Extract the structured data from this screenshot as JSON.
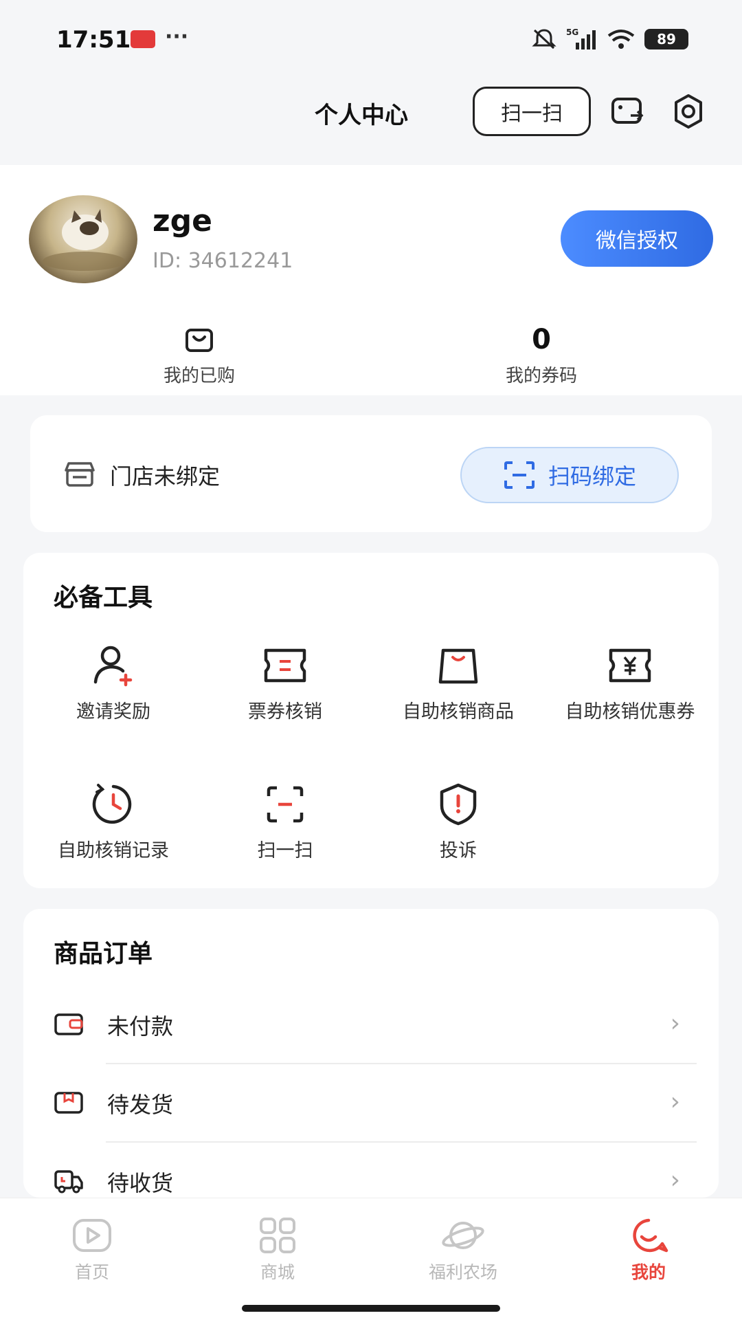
{
  "status_bar": {
    "time": "17:51",
    "dots": "···",
    "network": "5G",
    "battery": "89",
    "icons": [
      "app-notification-icon",
      "mute-icon",
      "signal-icon",
      "wifi-icon",
      "battery-icon"
    ]
  },
  "header": {
    "title": "个人中心",
    "scan_button": "扫一扫",
    "icons": [
      "card-switch-icon",
      "settings-icon"
    ]
  },
  "profile": {
    "name": "zge",
    "id_text": "ID: 34612241",
    "wechat_button": "微信授权",
    "stats": [
      {
        "value": "",
        "label": "我的已购",
        "icon": "bag-icon"
      },
      {
        "value": "0",
        "label": "我的券码"
      }
    ]
  },
  "store": {
    "status_text": "门店未绑定",
    "bind_button": "扫码绑定"
  },
  "tools": {
    "title": "必备工具",
    "items": [
      {
        "label": "邀请奖励",
        "icon": "invite-user-icon"
      },
      {
        "label": "票券核销",
        "icon": "ticket-icon"
      },
      {
        "label": "自助核销商品",
        "icon": "product-bag-icon"
      },
      {
        "label": "自助核销优惠券",
        "icon": "coupon-yen-icon"
      },
      {
        "label": "自助核销记录",
        "icon": "history-clock-icon"
      },
      {
        "label": "扫一扫",
        "icon": "scan-icon"
      },
      {
        "label": "投诉",
        "icon": "complaint-shield-icon"
      }
    ]
  },
  "orders": {
    "title": "商品订单",
    "rows": [
      {
        "label": "未付款",
        "icon": "wallet-icon"
      },
      {
        "label": "待发货",
        "icon": "package-icon"
      },
      {
        "label": "待收货",
        "icon": "truck-icon"
      }
    ]
  },
  "bottom_nav": {
    "items": [
      {
        "label": "首页",
        "icon": "play-home-icon"
      },
      {
        "label": "商城",
        "icon": "grid-mall-icon"
      },
      {
        "label": "福利农场",
        "icon": "planet-icon"
      },
      {
        "label": "我的",
        "icon": "smile-profile-icon",
        "active": true
      }
    ]
  },
  "colors": {
    "accent_blue": "#2f6be3",
    "accent_red": "#e8453c",
    "text_dark": "#222222",
    "text_muted": "#999999"
  }
}
